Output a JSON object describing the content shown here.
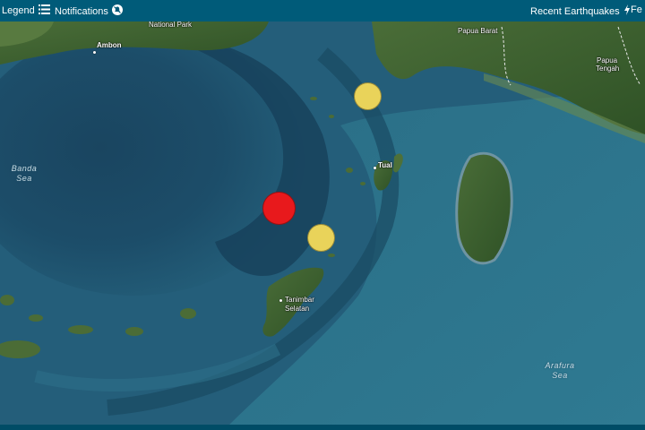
{
  "toolbar": {
    "legend_label": "Legend",
    "notifications_label": "Notifications",
    "recent_label": "Recent Earthquakes",
    "feed_label": "Fe"
  },
  "map": {
    "places": {
      "national_park": "National Park",
      "ambon": "Ambon",
      "papua_barat": "Papua Barat",
      "papua_tengah_1": "Papua",
      "papua_tengah_2": "Tengah",
      "tual": "Tual",
      "tanimbar_1": "Tanimbar",
      "tanimbar_2": "Selatan"
    },
    "seas": {
      "banda_1": "Banda",
      "banda_2": "Sea",
      "arafura_1": "Arafura",
      "arafura_2": "Sea"
    }
  },
  "earthquakes": [
    {
      "id": "quake-large",
      "color": "#e8191c"
    },
    {
      "id": "quake-north",
      "color": "#e9d35a"
    },
    {
      "id": "quake-south",
      "color": "#e9d35a"
    }
  ],
  "colors": {
    "toolbar": "#005b79",
    "deep_water": "#1a4d68",
    "shallow_water": "#2c7289",
    "land": "#3c5f2c"
  },
  "icons": {
    "legend": "list-icon",
    "notifications": "bell-off-icon",
    "recent": "lightning-icon"
  }
}
